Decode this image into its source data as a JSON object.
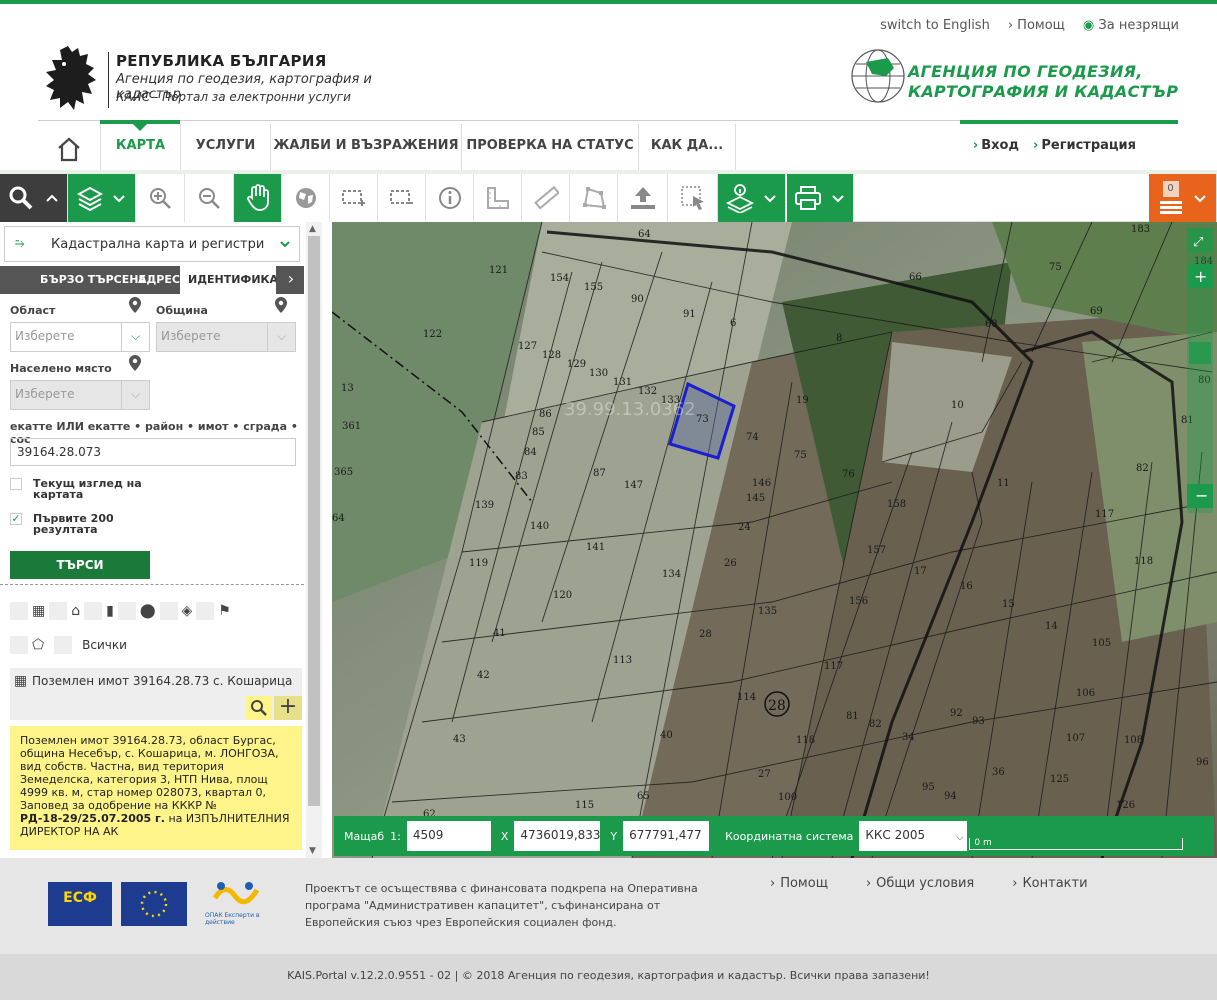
{
  "top_links": {
    "english": "switch to English",
    "help": "Помощ",
    "accessibility": "За незрящи"
  },
  "header": {
    "title": "РЕПУБЛИКА БЪЛГАРИЯ",
    "agency": "Агенция по геодезия, картография и кадастър",
    "portal": "КАИС - Портал за електронни услуги",
    "right_logo_line1": "АГЕНЦИЯ ПО ГЕОДЕЗИЯ,",
    "right_logo_line2": "КАРТОГРАФИЯ И КАДАСТЪР"
  },
  "nav": {
    "items": [
      {
        "label": "КАРТА"
      },
      {
        "label": "УСЛУГИ"
      },
      {
        "label": "ЖАЛБИ И ВЪЗРАЖЕНИЯ"
      },
      {
        "label": "ПРОВЕРКА НА СТАТУС"
      },
      {
        "label": "КАК ДА..."
      }
    ],
    "login": "Вход",
    "register": "Регистрация"
  },
  "toolbar": {
    "basket_count": "0"
  },
  "panel": {
    "layer": "Кадастрална карта и регистри",
    "tabs": [
      "БЪРЗО ТЪРСЕНЕ",
      "АДРЕС",
      "ИДЕНТИФИКАТО"
    ],
    "oblast_label": "Област",
    "obshtina_label": "Община",
    "naseleno_label": "Населено място",
    "select_placeholder": "Изберете",
    "ident_label": "екатте ИЛИ екатте • район • имот • сграда • сос",
    "ident_value": "39164.28.073",
    "check_current_view": "Текущ изглед на картата",
    "check_first200": "Първите 200 резултата",
    "check_first200_mark": "✓",
    "search_button": "ТЪРСИ",
    "filter_all": "Всички",
    "result_title": "Поземлен имот 39164.28.73 с. Кошарица",
    "result_info": "Поземлен имот 39164.28.73, област Бургас, община Несебър, с. Кошарица, м. ЛОНГОЗА, вид собств. Частна, вид територия Земеделска, категория 3, НТП Нива, площ 4999 кв. м, стар номер 028073, квартал 0,",
    "result_order": "Заповед за одобрение на КККР №",
    "result_order_no": "РД-18-29/25.07.2005 г.",
    "result_order_by": " на ИЗПЪЛНИТЕЛНИЯ ДИРЕКТОР НА АК"
  },
  "map": {
    "parcel_label": "39164.28.73",
    "parcel_watermark": "39.99.13.0362",
    "locality_badge": "28",
    "parcel_numbers": [
      "64",
      "121",
      "154",
      "155",
      "90",
      "91",
      "6",
      "8",
      "66",
      "68",
      "75",
      "69",
      "183",
      "184",
      "122",
      "127",
      "128",
      "129",
      "130",
      "131",
      "132",
      "133",
      "73",
      "74",
      "75",
      "76",
      "19",
      "10",
      "80",
      "81",
      "13",
      "361",
      "86",
      "85",
      "84",
      "83",
      "87",
      "147",
      "146",
      "145",
      "24",
      "26",
      "11",
      "82",
      "158",
      "117",
      "365",
      "139",
      "140",
      "141",
      "134",
      "135",
      "157",
      "17",
      "16",
      "15",
      "14",
      "118",
      "105",
      "119",
      "120",
      "41",
      "42",
      "43",
      "113",
      "114",
      "28",
      "117",
      "118",
      "156",
      "81",
      "82",
      "34",
      "92",
      "93",
      "36",
      "107",
      "106",
      "108",
      "125",
      "126",
      "96",
      "40",
      "65",
      "115",
      "27",
      "100",
      "95",
      "94",
      "62",
      "64"
    ],
    "scale_label": "Мащаб",
    "scale_prefix": "1:",
    "scale_value": "4509",
    "x_label": "X",
    "x_value": "4736019,833",
    "y_label": "Y",
    "y_value": "677791,477",
    "crs_label": "Координатна система",
    "crs_value": "ККС 2005",
    "scale_bar": "0 m"
  },
  "footer": {
    "text": "Проектът се осъществява с финансовата подкрепа на Оперативна програма \"Административен капацитет\", съфинансирана от Европейския съюз чрез Европейския социален фонд.",
    "links": [
      "Помощ",
      "Общи условия",
      "Контакти"
    ],
    "esf_label": "ЕСФ",
    "opak_label": "ОПАК Експерти в действие",
    "copyright": "KAIS.Portal v.12.2.0.9551 - 02  |  © 2018 Агенция по геодезия, картография и кадастър. Всички права запазени!"
  }
}
